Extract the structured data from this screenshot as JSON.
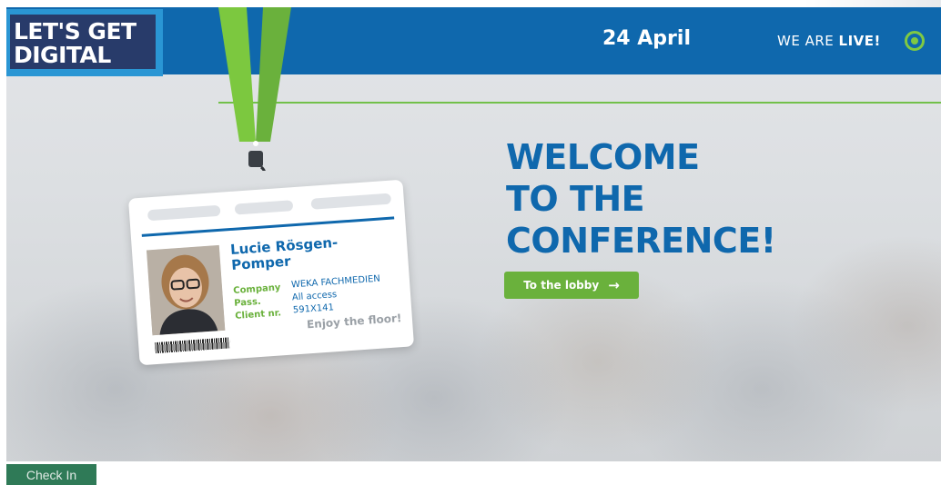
{
  "header": {
    "logo_line1": "LET'S GET",
    "logo_line2": "DIGITAL",
    "date": "24 April",
    "live_prefix": "WE ARE ",
    "live_emphasis": "LIVE!",
    "live_icon": "live-target-icon"
  },
  "badge": {
    "name": "Lucie Rösgen-Pomper",
    "fields": [
      {
        "label": "Company",
        "value": "WEKA FACHMEDIEN"
      },
      {
        "label": "Pass.",
        "value": "All access"
      },
      {
        "label": "Client nr.",
        "value": "591X141"
      }
    ],
    "tagline": "Enjoy the floor!"
  },
  "hero": {
    "line1": "WELCOME",
    "line2": "TO THE",
    "line3": "CONFERENCE!",
    "cta_label": "To the lobby",
    "cta_icon": "arrow-right-icon"
  },
  "footer": {
    "checkin_label": "Check In"
  },
  "colors": {
    "brand_blue": "#0f68ad",
    "accent_green": "#6ab13c",
    "logo_navy": "#283b6a",
    "checkin_green": "#2f7a57"
  }
}
